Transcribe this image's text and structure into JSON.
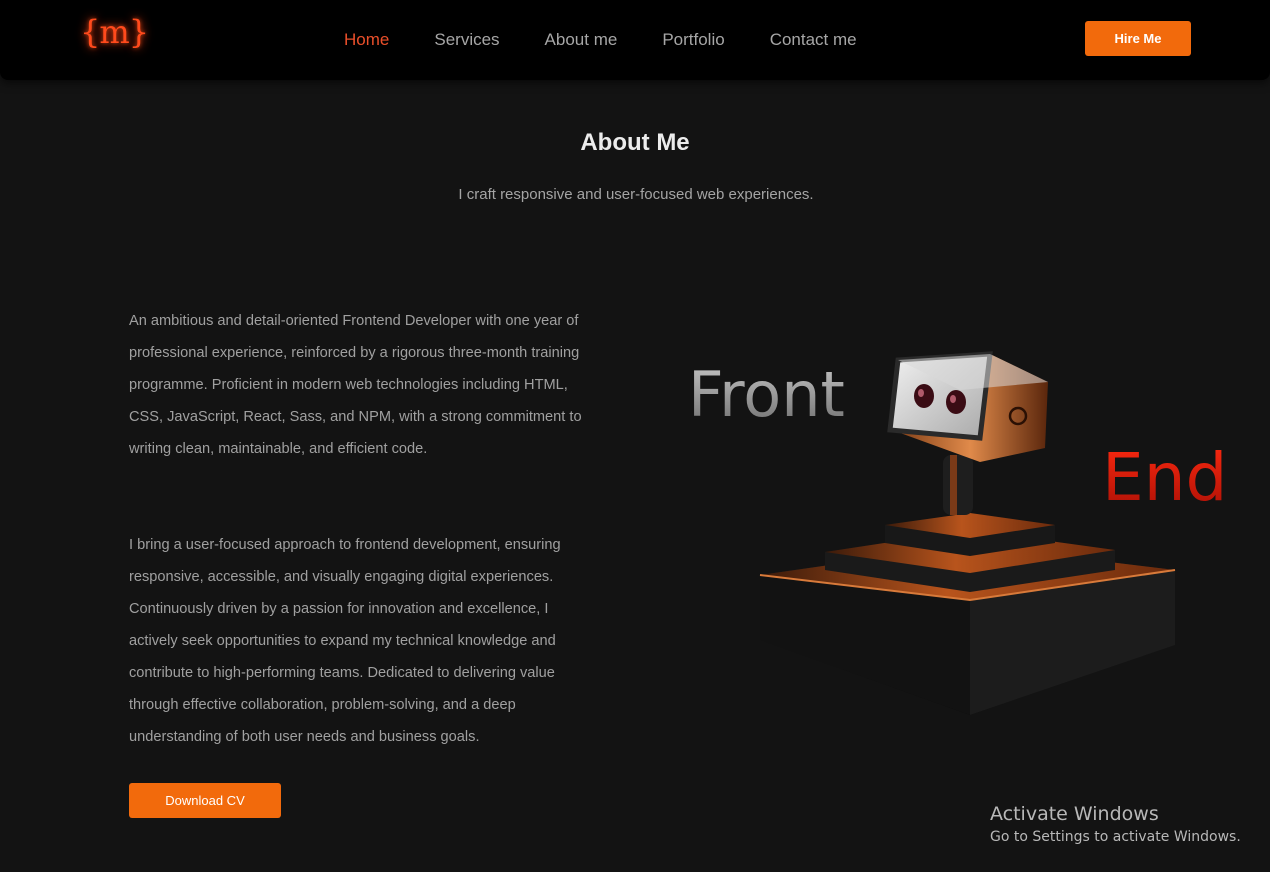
{
  "header": {
    "logo_text": "{m}",
    "nav": [
      {
        "label": "Home",
        "active": true
      },
      {
        "label": "Services",
        "active": false
      },
      {
        "label": "About me",
        "active": false
      },
      {
        "label": "Portfolio",
        "active": false
      },
      {
        "label": "Contact me",
        "active": false
      }
    ],
    "hire_button": "Hire Me"
  },
  "about": {
    "title": "About Me",
    "subtitle": "I craft responsive and user-focused web experiences.",
    "paragraphs": [
      "An ambitious and detail-oriented Frontend Developer with one year of professional experience, reinforced by a rigorous three-month training programme. Proficient in modern web technologies including HTML, CSS, JavaScript, React, Sass, and NPM, with a strong commitment to writing clean, maintainable, and efficient code.",
      "I bring a user-focused approach to frontend development, ensuring responsive, accessible, and visually engaging digital experiences. Continuously driven by a passion for innovation and excellence, I actively seek opportunities to expand my technical knowledge and contribute to high-performing teams. Dedicated to delivering value through effective collaboration, problem-solving, and a deep understanding of both user needs and business goals."
    ],
    "download_button": "Download CV"
  },
  "illustration": {
    "word_left": "Front",
    "word_right": "End"
  },
  "watermark": {
    "title": "Activate Windows",
    "subtitle": "Go to Settings to activate Windows."
  },
  "colors": {
    "accent": "#f26a0c",
    "active_nav": "#ea4f2a",
    "logo": "#ff4a1c",
    "background": "#131313",
    "navbar": "#000000"
  }
}
